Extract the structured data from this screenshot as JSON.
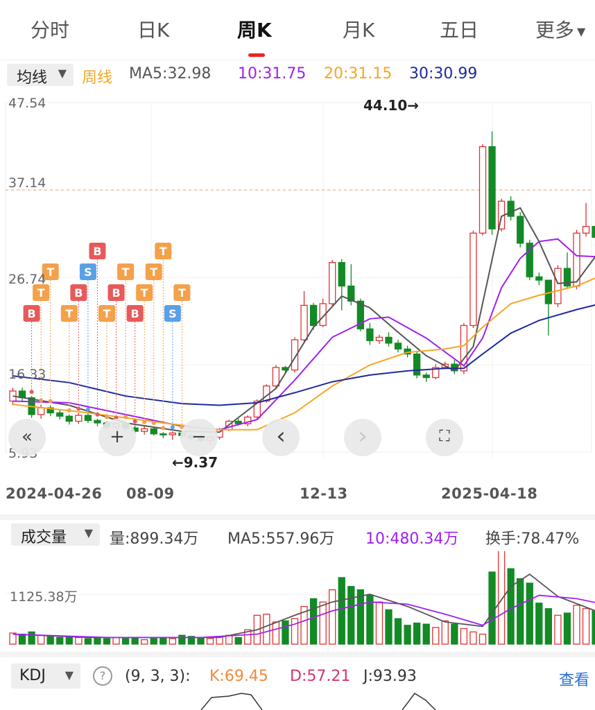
{
  "tabs": [
    {
      "label": "分时"
    },
    {
      "label": "日K"
    },
    {
      "label": "周K"
    },
    {
      "label": "月K"
    },
    {
      "label": "五日"
    },
    {
      "label": "更多"
    }
  ],
  "active_tab": "周K",
  "more_icon": "caret-down-icon",
  "ma": {
    "selector": "均线",
    "type": "周线",
    "ma5": "MA5:32.98",
    "ma10": "10:31.75",
    "ma20": "20:31.15",
    "ma30": "30:30.99"
  },
  "colors": {
    "up": "#e03131",
    "down": "#138a25",
    "ma5": "#555555",
    "ma10": "#a020f0",
    "ma20": "#f5a623",
    "ma30": "#1d2a9e",
    "badge_t": "#f5a04a",
    "badge_b": "#e85a5a",
    "badge_s": "#5aa0e8",
    "link": "#2b6fd6"
  },
  "y_axis": [
    "47.54",
    "37.14",
    "26.74",
    "16.33",
    "5.93"
  ],
  "annotations": {
    "high": "44.10→",
    "low": "←9.37"
  },
  "x_axis": [
    "2024-04-26",
    "08-09",
    "12-13",
    "2025-04-18"
  ],
  "controls": [
    {
      "icon": "rewind-icon",
      "glyph": "«",
      "enabled": true
    },
    {
      "icon": "zoom-in-icon",
      "glyph": "+",
      "enabled": true
    },
    {
      "icon": "zoom-out-icon",
      "glyph": "−",
      "enabled": true
    },
    {
      "icon": "chevron-left-icon",
      "glyph": "‹",
      "enabled": true
    },
    {
      "icon": "chevron-right-icon",
      "glyph": "›",
      "enabled": false
    },
    {
      "icon": "fullscreen-icon",
      "glyph": "⛶",
      "enabled": true
    }
  ],
  "volume": {
    "selector": "成交量",
    "vol": "量:899.34万",
    "ma5": "MA5:557.96万",
    "ma10": "10:480.34万",
    "turnover": "换手:78.47%",
    "axis_label": "1125.38万"
  },
  "kdj": {
    "selector": "KDJ",
    "params": "(9, 3, 3):",
    "k": "K:69.45",
    "d": "D:57.21",
    "j": "J:93.93",
    "link": "查看"
  },
  "chart_data": {
    "type": "candlestick",
    "y_range": [
      5.93,
      47.54
    ],
    "ref_line": 37.14,
    "candles": [
      [
        12.0,
        13.2,
        11.5,
        13.6
      ],
      [
        13.2,
        12.4,
        11.9,
        13.6
      ],
      [
        12.4,
        10.4,
        10.0,
        12.6
      ],
      [
        10.4,
        11.2,
        9.9,
        11.6
      ],
      [
        11.2,
        10.6,
        10.2,
        11.5
      ],
      [
        10.6,
        10.2,
        9.8,
        10.9
      ],
      [
        10.2,
        9.6,
        9.2,
        10.4
      ],
      [
        9.6,
        10.3,
        9.3,
        10.6
      ],
      [
        10.3,
        9.7,
        9.4,
        10.5
      ],
      [
        9.7,
        9.4,
        9.0,
        9.9
      ],
      [
        9.4,
        8.9,
        8.6,
        9.6
      ],
      [
        8.9,
        9.3,
        8.6,
        9.5
      ],
      [
        9.3,
        8.8,
        8.5,
        9.6
      ],
      [
        8.8,
        8.4,
        8.1,
        9.1
      ],
      [
        8.4,
        8.7,
        8.0,
        9.0
      ],
      [
        8.7,
        8.1,
        7.9,
        8.9
      ],
      [
        8.1,
        8.0,
        7.6,
        8.3
      ],
      [
        8.0,
        8.2,
        7.4,
        8.4
      ],
      [
        8.2,
        7.9,
        7.6,
        8.4
      ],
      [
        7.9,
        7.6,
        7.2,
        8.1
      ],
      [
        7.6,
        7.3,
        7.0,
        7.9
      ],
      [
        7.3,
        7.7,
        6.8,
        7.9
      ],
      [
        7.7,
        8.6,
        7.4,
        8.8
      ],
      [
        8.6,
        9.6,
        8.4,
        9.8
      ],
      [
        9.6,
        9.3,
        9.1,
        9.9
      ],
      [
        9.3,
        10.1,
        9.0,
        10.3
      ],
      [
        10.1,
        12.0,
        9.9,
        12.2
      ],
      [
        12.0,
        13.8,
        11.8,
        14.0
      ],
      [
        13.8,
        16.0,
        13.5,
        16.3
      ],
      [
        16.0,
        15.7,
        15.3,
        16.2
      ],
      [
        15.7,
        19.3,
        15.4,
        19.6
      ],
      [
        19.3,
        23.4,
        19.1,
        25.1
      ],
      [
        23.4,
        21.0,
        20.5,
        23.7
      ],
      [
        21.0,
        23.6,
        20.8,
        24.2
      ],
      [
        23.6,
        28.5,
        23.3,
        28.8
      ],
      [
        28.5,
        25.7,
        22.8,
        28.9
      ],
      [
        25.7,
        23.9,
        23.4,
        28.3
      ],
      [
        23.9,
        20.6,
        20.3,
        24.2
      ],
      [
        20.6,
        19.2,
        18.7,
        21.3
      ],
      [
        19.2,
        19.6,
        18.8,
        19.9
      ],
      [
        19.6,
        18.9,
        18.5,
        20.2
      ],
      [
        18.9,
        18.2,
        17.8,
        19.3
      ],
      [
        18.2,
        17.6,
        17.2,
        18.6
      ],
      [
        17.6,
        15.1,
        14.7,
        17.9
      ],
      [
        15.1,
        14.8,
        14.3,
        15.4
      ],
      [
        14.8,
        16.0,
        14.6,
        16.4
      ],
      [
        16.0,
        16.4,
        15.8,
        16.7
      ],
      [
        16.4,
        15.6,
        15.2,
        16.9
      ],
      [
        15.6,
        21.0,
        15.2,
        21.3
      ],
      [
        21.0,
        32.0,
        20.7,
        32.3
      ],
      [
        32.0,
        42.3,
        31.7,
        42.6
      ],
      [
        42.3,
        32.5,
        31.8,
        44.1
      ],
      [
        32.5,
        35.8,
        32.2,
        36.1
      ],
      [
        35.8,
        34.0,
        33.5,
        36.4
      ],
      [
        34.0,
        30.8,
        30.3,
        34.5
      ],
      [
        30.8,
        26.8,
        26.4,
        31.2
      ],
      [
        26.8,
        26.4,
        25.8,
        27.3
      ],
      [
        26.4,
        23.6,
        19.8,
        24.2
      ],
      [
        23.6,
        27.8,
        23.2,
        28.2
      ],
      [
        27.8,
        25.7,
        25.4,
        29.7
      ],
      [
        25.7,
        32.0,
        25.3,
        32.4
      ],
      [
        32.0,
        32.8,
        31.6,
        35.6
      ],
      [
        32.8,
        31.5,
        30.4,
        34.6
      ],
      [
        31.5,
        28.9,
        28.4,
        32.0
      ],
      [
        28.9,
        27.6,
        26.9,
        29.3
      ],
      [
        27.6,
        29.7,
        27.3,
        30.6
      ],
      [
        29.7,
        27.0,
        26.6,
        30.2
      ],
      [
        27.0,
        28.0,
        26.8,
        28.4
      ],
      [
        28.0,
        29.6,
        26.9,
        30.2
      ],
      [
        29.6,
        27.3,
        26.7,
        31.7
      ],
      [
        27.3,
        29.3,
        27.0,
        30.2
      ]
    ],
    "ma_series": [
      {
        "name": "MA5",
        "color": "#555555",
        "values": [
          [
            0,
            12.6
          ],
          [
            6,
            11.5
          ],
          [
            12,
            9.4
          ],
          [
            18,
            8.4
          ],
          [
            22,
            8.3
          ],
          [
            28,
            13.5
          ],
          [
            32,
            20.8
          ],
          [
            35,
            24.5
          ],
          [
            38,
            23.1
          ],
          [
            41,
            20.2
          ],
          [
            44,
            17.4
          ],
          [
            47,
            15.6
          ],
          [
            49,
            18.5
          ],
          [
            52,
            34.0
          ],
          [
            54,
            35.0
          ],
          [
            56,
            31.0
          ],
          [
            58,
            26.0
          ],
          [
            60,
            26.2
          ],
          [
            62,
            29.2
          ],
          [
            64,
            31.2
          ],
          [
            66,
            29.8
          ],
          [
            68,
            28.6
          ],
          [
            70,
            28.1
          ]
        ]
      },
      {
        "name": "MA10",
        "color": "#a020f0",
        "values": [
          [
            0,
            12.0
          ],
          [
            6,
            11.8
          ],
          [
            12,
            10.4
          ],
          [
            18,
            9.0
          ],
          [
            22,
            8.6
          ],
          [
            26,
            9.8
          ],
          [
            30,
            14.5
          ],
          [
            34,
            19.6
          ],
          [
            38,
            21.8
          ],
          [
            40,
            22.0
          ],
          [
            44,
            19.5
          ],
          [
            48,
            16.2
          ],
          [
            50,
            19.5
          ],
          [
            52,
            25.5
          ],
          [
            54,
            29.0
          ],
          [
            56,
            31.0
          ],
          [
            58,
            31.3
          ],
          [
            60,
            29.3
          ],
          [
            62,
            29.2
          ],
          [
            64,
            30.2
          ],
          [
            66,
            29.4
          ],
          [
            68,
            28.9
          ],
          [
            70,
            29.8
          ]
        ]
      },
      {
        "name": "MA20",
        "color": "#f5a623",
        "values": [
          [
            0,
            11.6
          ],
          [
            8,
            10.6
          ],
          [
            16,
            9.4
          ],
          [
            22,
            8.6
          ],
          [
            26,
            8.6
          ],
          [
            30,
            10.6
          ],
          [
            34,
            13.8
          ],
          [
            38,
            16.3
          ],
          [
            42,
            17.8
          ],
          [
            46,
            18.2
          ],
          [
            48,
            18.6
          ],
          [
            50,
            20.8
          ],
          [
            53,
            23.6
          ],
          [
            56,
            24.6
          ],
          [
            60,
            25.7
          ],
          [
            64,
            27.6
          ],
          [
            68,
            29.5
          ],
          [
            70,
            31.0
          ]
        ]
      },
      {
        "name": "MA30",
        "color": "#1d2a9e",
        "values": [
          [
            0,
            15.0
          ],
          [
            6,
            14.2
          ],
          [
            12,
            12.6
          ],
          [
            18,
            11.7
          ],
          [
            22,
            11.5
          ],
          [
            26,
            11.8
          ],
          [
            30,
            13.0
          ],
          [
            34,
            14.3
          ],
          [
            38,
            15.1
          ],
          [
            42,
            15.6
          ],
          [
            46,
            15.9
          ],
          [
            48,
            15.9
          ],
          [
            50,
            17.6
          ],
          [
            53,
            20.1
          ],
          [
            56,
            21.6
          ],
          [
            60,
            22.9
          ],
          [
            64,
            24.0
          ],
          [
            68,
            25.3
          ],
          [
            70,
            26.2
          ]
        ]
      }
    ],
    "volume": {
      "y_max": 1700,
      "values": [
        1.0,
        0.9,
        1.1,
        0.8,
        0.7,
        0.6,
        0.7,
        0.6,
        0.5,
        0.6,
        0.5,
        0.6,
        0.5,
        0.6,
        0.4,
        0.5,
        0.6,
        0.5,
        0.8,
        0.7,
        0.6,
        0.5,
        0.7,
        0.8,
        0.6,
        1.3,
        2.6,
        2.7,
        2.0,
        2.1,
        2.3,
        3.4,
        4.1,
        3.8,
        4.9,
        6.0,
        5.2,
        4.9,
        4.4,
        3.8,
        3.1,
        2.3,
        1.7,
        1.9,
        1.8,
        1.5,
        2.1,
        1.8,
        1.4,
        1.1,
        0.9,
        6.5,
        8.5,
        6.8,
        5.9,
        5.5,
        3.7,
        3.2,
        2.6,
        2.8,
        3.5,
        3.2,
        3.0,
        3.1,
        3.2,
        2.9,
        2.2,
        1.9,
        1.6,
        1.4,
        1.7
      ],
      "ma5": [
        [
          0,
          0.9
        ],
        [
          8,
          0.6
        ],
        [
          16,
          0.6
        ],
        [
          22,
          0.6
        ],
        [
          26,
          1.3
        ],
        [
          30,
          2.6
        ],
        [
          34,
          3.8
        ],
        [
          38,
          4.5
        ],
        [
          42,
          3.4
        ],
        [
          46,
          2.0
        ],
        [
          50,
          1.6
        ],
        [
          53,
          5.2
        ],
        [
          55,
          6.3
        ],
        [
          58,
          4.3
        ],
        [
          62,
          3.0
        ],
        [
          66,
          3.0
        ],
        [
          70,
          1.9
        ]
      ],
      "ma10": [
        [
          0,
          0.9
        ],
        [
          10,
          0.6
        ],
        [
          20,
          0.6
        ],
        [
          26,
          0.9
        ],
        [
          30,
          1.8
        ],
        [
          34,
          3.0
        ],
        [
          38,
          3.8
        ],
        [
          42,
          3.6
        ],
        [
          46,
          2.7
        ],
        [
          50,
          1.7
        ],
        [
          53,
          3.2
        ],
        [
          56,
          4.4
        ],
        [
          60,
          4.1
        ],
        [
          64,
          3.4
        ],
        [
          70,
          2.3
        ]
      ]
    },
    "kdj_tops": {
      "K": "K:69.45",
      "D": "D:57.21",
      "J": "J:93.93"
    },
    "signals": [
      {
        "i": 2,
        "label": "B",
        "level": 0
      },
      {
        "i": 3,
        "label": "T",
        "level": 1
      },
      {
        "i": 4,
        "label": "T",
        "level": 2
      },
      {
        "i": 6,
        "label": "T",
        "level": 0
      },
      {
        "i": 7,
        "label": "B",
        "level": 1
      },
      {
        "i": 8,
        "label": "S",
        "level": 2
      },
      {
        "i": 9,
        "label": "B",
        "level": 3
      },
      {
        "i": 10,
        "label": "T",
        "level": 0
      },
      {
        "i": 11,
        "label": "B",
        "level": 1
      },
      {
        "i": 12,
        "label": "T",
        "level": 2
      },
      {
        "i": 13,
        "label": "B",
        "level": 0
      },
      {
        "i": 14,
        "label": "T",
        "level": 1
      },
      {
        "i": 15,
        "label": "T",
        "level": 2
      },
      {
        "i": 16,
        "label": "T",
        "level": 3
      },
      {
        "i": 17,
        "label": "S",
        "level": 0
      },
      {
        "i": 18,
        "label": "T",
        "level": 1
      }
    ]
  }
}
